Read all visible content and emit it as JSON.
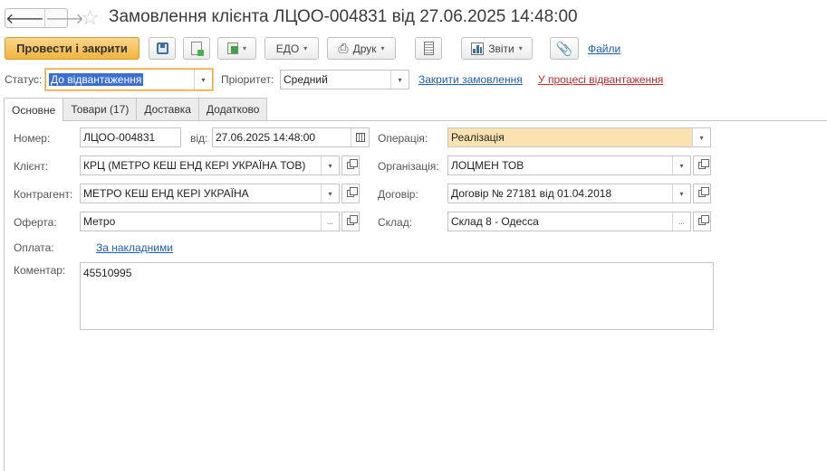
{
  "window": {
    "title": "Замовлення клієнта ЛЦОО-004831 від 27.06.2025 14:48:00",
    "back_glyph": "🡐",
    "forward_glyph": "🡒",
    "star_glyph": "☆"
  },
  "toolbar": {
    "post_close_label": "Провести і закрити",
    "edo_label": "ЕДО",
    "print_label": "Друк",
    "reports_label": "Звіти",
    "files_label": "Файли",
    "caret": "▾"
  },
  "status_row": {
    "status_label": "Статус:",
    "status_value": "До відвантаження",
    "priority_label": "Пріоритет:",
    "priority_value": "Средний",
    "close_order_link": "Закрити замовлення",
    "in_shipping_link": "У процесі відвантаження"
  },
  "tabs": [
    {
      "label": "Основне",
      "active": true
    },
    {
      "label": "Товари (17)",
      "active": false
    },
    {
      "label": "Доставка",
      "active": false
    },
    {
      "label": "Додатково",
      "active": false
    }
  ],
  "form": {
    "number_label": "Номер:",
    "number_value": "ЛЦОО-004831",
    "date_label": "від:",
    "date_value": "27.06.2025 14:48:00",
    "operation_label": "Операція:",
    "operation_value": "Реалізація",
    "client_label": "Клієнт:",
    "client_value": "КРЦ (МЕТРО КЕШ ЕНД КЕРІ УКРАЇНА ТОВ)",
    "organization_label": "Організація:",
    "organization_value": "ЛОЦМЕН ТОВ",
    "counterparty_label": "Контрагент:",
    "counterparty_value": "МЕТРО КЕШ ЕНД КЕРІ УКРАЇНА",
    "contract_label": "Договір:",
    "contract_value": "Договір № 27181 від 01.04.2018",
    "offer_label": "Оферта:",
    "offer_value": "Метро",
    "warehouse_label": "Склад:",
    "warehouse_value": "Склад 8 - Одесса",
    "payment_label": "Оплата:",
    "payment_link": "За накладними",
    "comment_label": "Коментар:",
    "comment_value": "45510995",
    "ellipsis": "..."
  },
  "colors": {
    "primary_button": "#f1b43e",
    "operation_field": "#fbe2b0",
    "link": "#1b5fb5",
    "link_red": "#c62828",
    "selection": "#3b6fd6"
  }
}
